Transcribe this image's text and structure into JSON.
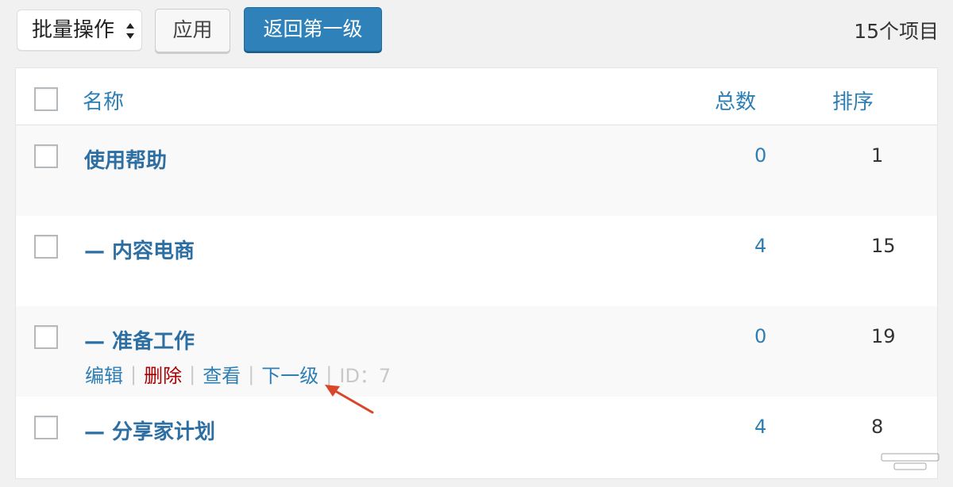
{
  "toolbar": {
    "bulk_action_label": "批量操作",
    "apply_label": "应用",
    "back_label": "返回第一级",
    "item_count": "15个项目"
  },
  "table": {
    "headers": {
      "name": "名称",
      "count": "总数",
      "order": "排序"
    },
    "rows": [
      {
        "name": "使用帮助",
        "count": "0",
        "order": "1"
      },
      {
        "name": "— 内容电商",
        "count": "4",
        "order": "15"
      },
      {
        "name": "— 准备工作",
        "count": "0",
        "order": "19",
        "actions": {
          "edit": "编辑",
          "delete": "删除",
          "view": "查看",
          "next_level": "下一级",
          "id": "ID：7"
        }
      },
      {
        "name": "— 分享家计划",
        "count": "4",
        "order": "8"
      }
    ]
  },
  "colors": {
    "primary_blue": "#2f82b9",
    "link_blue": "#2d7eb3",
    "delete_red": "#aa0000",
    "annotation_arrow": "#d9472b"
  }
}
